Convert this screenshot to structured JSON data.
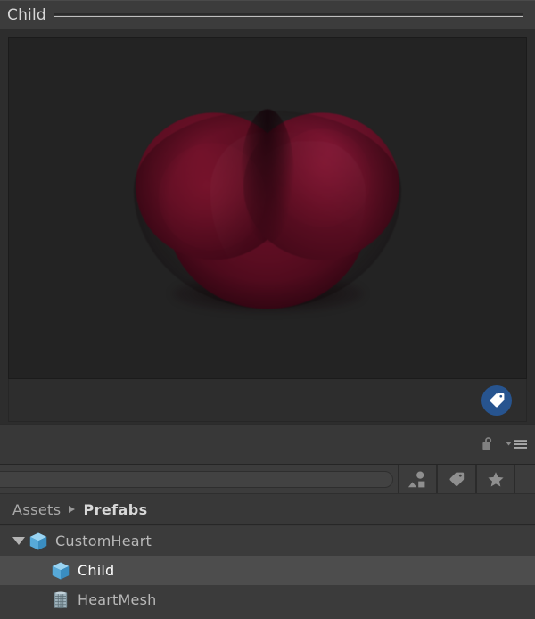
{
  "window": {
    "title": "Child"
  },
  "preview": {
    "object_name": "Child",
    "background_color": "#232323",
    "mesh_color": "#5d0e22",
    "mesh_shape": "low-poly-heart",
    "toolbar": {
      "tag_badge_label": "tag-icon",
      "tag_badge_color": "#27548f"
    }
  },
  "lock_strip": {
    "lock_icon_label": "lock-open-icon",
    "menu_icon_label": "options-menu-icon"
  },
  "search": {
    "value": "",
    "placeholder": ""
  },
  "toolbar_buttons": [
    {
      "name": "prefab-filter-button",
      "icon": "shapes-icon"
    },
    {
      "name": "label-filter-button",
      "icon": "tag-icon"
    },
    {
      "name": "favorite-filter-button",
      "icon": "star-icon"
    }
  ],
  "breadcrumb": {
    "items": [
      {
        "label": "Assets",
        "current": false
      },
      {
        "label": "Prefabs",
        "current": true
      }
    ],
    "separator": "▶"
  },
  "tree": {
    "items": [
      {
        "label": "CustomHeart",
        "icon": "prefab-cube-icon",
        "depth": 0,
        "expanded": true,
        "selected": false
      },
      {
        "label": "Child",
        "icon": "prefab-cube-icon",
        "depth": 1,
        "expanded": false,
        "selected": true
      },
      {
        "label": "HeartMesh",
        "icon": "mesh-icon",
        "depth": 1,
        "expanded": false,
        "selected": false
      }
    ]
  },
  "colors": {
    "panel_background": "#383838",
    "header_background": "#3c3c3c",
    "tree_background": "#3b3b3b",
    "selection_highlight": "#4d4d4d",
    "text_primary": "#d6d6d6",
    "text_secondary": "#a9a9a9",
    "accent_blue": "#27548f",
    "prefab_icon_blue": "#5fb4e8"
  }
}
